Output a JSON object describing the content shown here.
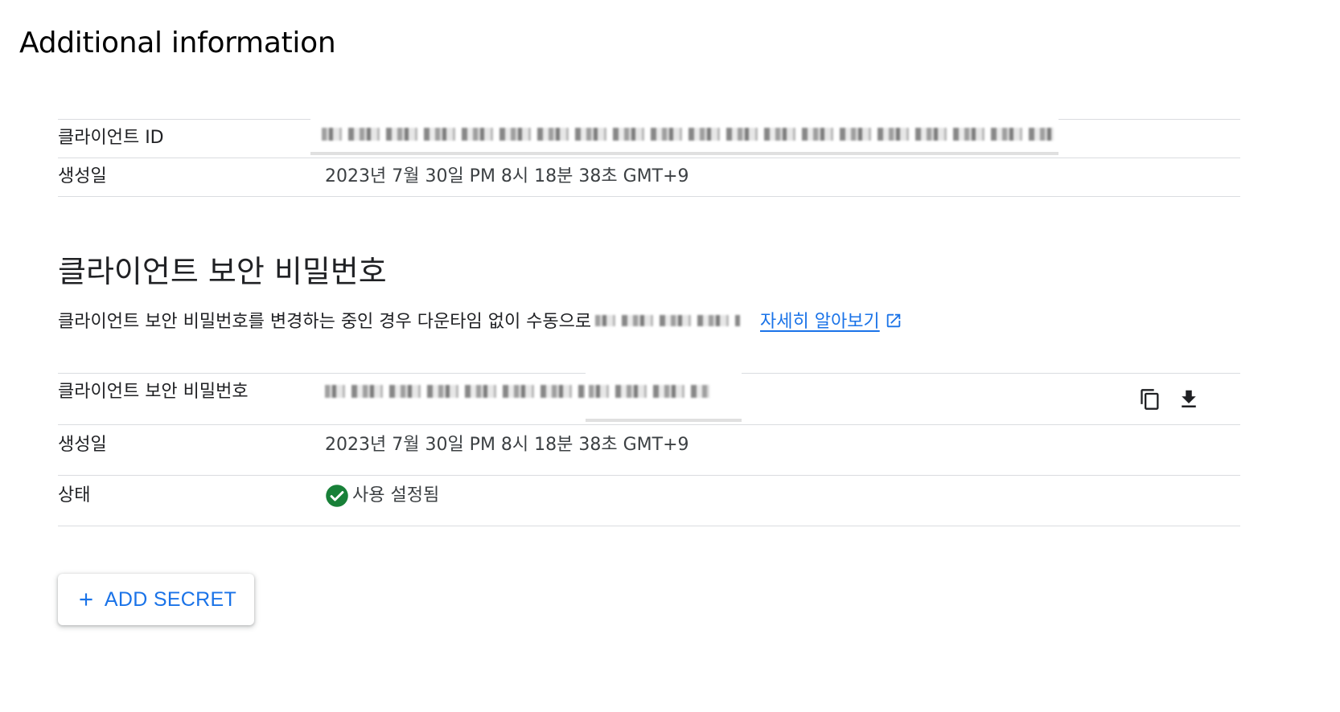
{
  "page": {
    "title": "Additional information"
  },
  "client_info": {
    "client_id_label": "클라이언트 ID",
    "created_label": "생성일",
    "created_value": "2023년 7월 30일 PM 8시 18분 38초 GMT+9"
  },
  "secret_section": {
    "heading": "클라이언트 보안 비밀번호",
    "description": "클라이언트 보안 비밀번호를 변경하는 중인 경우 다운타임 없이 수동으로",
    "learn_more_link": "자세히 알아보기",
    "secret_label": "클라이언트 보안 비밀번호",
    "created_label": "생성일",
    "created_value": "2023년 7월 30일 PM 8시 18분 38초 GMT+9",
    "status_label": "상태",
    "status_value": "사용 설정됨"
  },
  "actions": {
    "add_secret_label": "ADD SECRET"
  },
  "icons": {
    "copy": "copy-icon",
    "download": "download-icon",
    "external_link": "open-in-new-icon",
    "status_ok": "check-circle-icon",
    "add": "plus-icon"
  },
  "colors": {
    "accent": "#1a73e8",
    "success": "#188038",
    "divider": "#dadce0"
  }
}
